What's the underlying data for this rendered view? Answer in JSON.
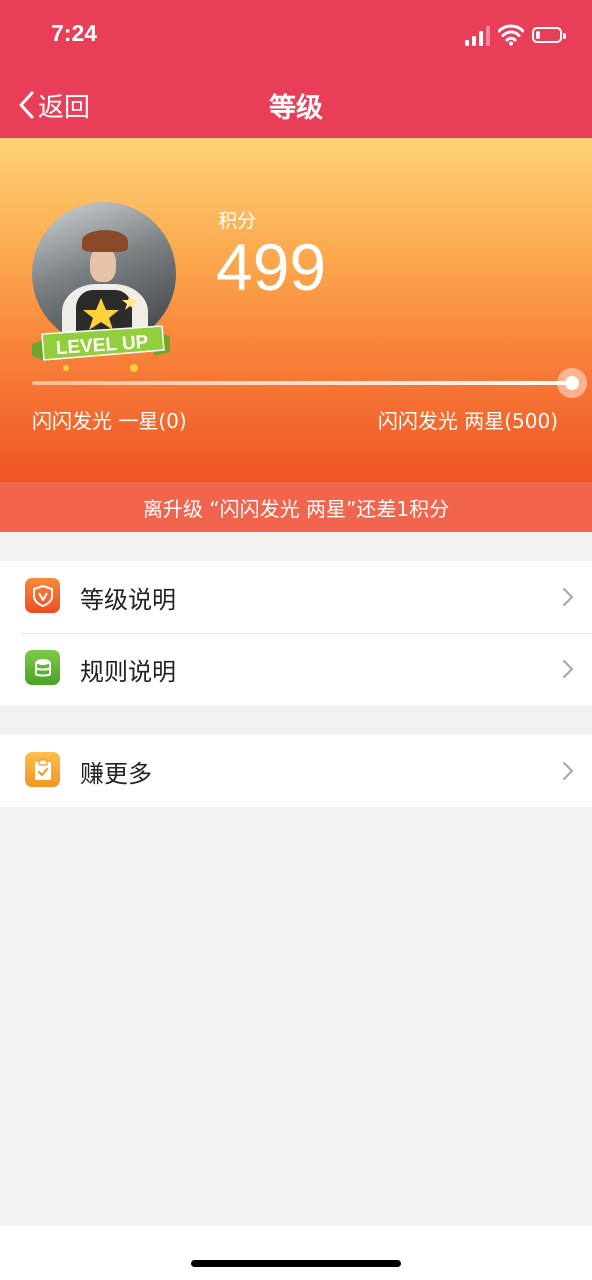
{
  "status_bar": {
    "time": "7:24",
    "battery_level": 0.2
  },
  "nav": {
    "back_label": "返回",
    "title": "等级"
  },
  "profile": {
    "badge_text": "LEVEL UP",
    "points_label": "积分",
    "points_value": "499",
    "progress_fraction": 1.0,
    "current_level": "闪闪发光 一星(0)",
    "next_level": "闪闪发光 两星(500)",
    "hint": "离升级 “闪闪发光 两星”还差1积分"
  },
  "menu": {
    "group_a": [
      {
        "label": "等级说明",
        "icon": "shield-v-icon",
        "color": "#f4612e"
      },
      {
        "label": "规则说明",
        "icon": "coins-icon",
        "color": "#5cb532"
      }
    ],
    "group_b": [
      {
        "label": "赚更多",
        "icon": "clipboard-check-icon",
        "color": "#f7a22c"
      }
    ]
  },
  "colors": {
    "nav_bg": "#e83e58",
    "hint_bg": "#f1644e",
    "gradient_top": "#fdd276",
    "gradient_bottom": "#ef5425"
  }
}
